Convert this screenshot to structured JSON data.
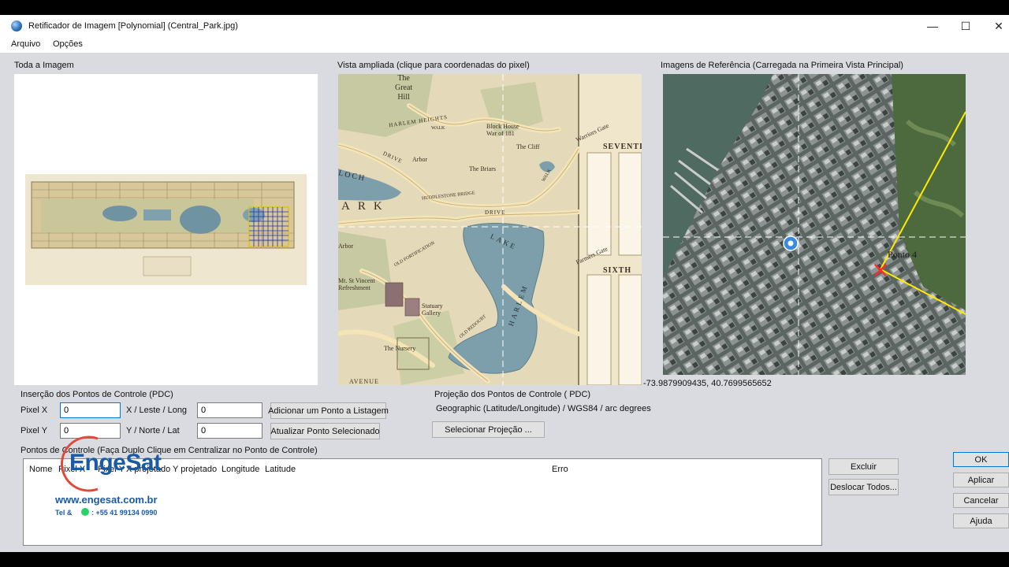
{
  "window": {
    "title": "Retificador de Imagem [Polynomial] (Central_Park.jpg)",
    "minimize_glyph": "—",
    "maximize_glyph": "☐",
    "close_glyph": "✕"
  },
  "menu": {
    "items": [
      "Arquivo",
      "Opções"
    ]
  },
  "panels": {
    "whole_image_label": "Toda a Imagem",
    "zoom_view_label": "Vista ampliada (clique para coordenadas do pixel)",
    "reference_label": "Imagens de Referência (Carregada na Primeira Vista Principal)",
    "coord_readout": "-73.9879909435, 40.7699565652"
  },
  "map_labels": {
    "the_great_hill": [
      "The",
      "Great",
      "Hill"
    ],
    "harlem_heights": "HARLEM HEIGHTS",
    "block_house": [
      "Block House",
      "War of 181"
    ],
    "warriors_gate": "Warriors Gate",
    "seventh": "SEVENTI",
    "the_cliff": "The Cliff",
    "arbor1": "Arbor",
    "the_briars": "The Briars",
    "drive": "DRIVE",
    "huddlestone": "HUDDLESTONE BRIDGE",
    "loch": "LOCH",
    "park_ark": "ARK",
    "harlem_lake": "HARLEM",
    "lake2": "LAKE",
    "farmers_gate": "Farmers Gate",
    "sixth": "SIXTH",
    "arbor2": "Arbor",
    "old_fortification": "OLD FORTIFICATION",
    "mt_st_vincent": [
      "Mt. St Vincent",
      "Refreshment"
    ],
    "statuary_gallery": [
      "Statuary",
      "Gallery"
    ],
    "old_redoubt": "OLD REDOUBT",
    "the_nursery": "The Nursery",
    "walk": "WALK",
    "avenue": "AVENUE",
    "ponto_label": "Ponto 4"
  },
  "pdc_insert": {
    "group_label": "Inserção dos Pontos de Controle (PDC)",
    "pixel_x_label": "Pixel X",
    "pixel_x_value": "0",
    "pixel_y_label": "Pixel Y",
    "pixel_y_value": "0",
    "x_east_label": "X / Leste / Long",
    "x_east_value": "0",
    "y_north_label": "Y / Norte / Lat",
    "y_north_value": "0",
    "add_button": "Adicionar um Ponto a Listagem",
    "update_button": "Atualizar Ponto Selecionado"
  },
  "projection": {
    "group_label": "Projeção dos Pontos de Controle ( PDC)",
    "value": "Geographic (Latitude/Longitude) / WGS84 / arc degrees",
    "select_button": "Selecionar Projeção ..."
  },
  "control_points": {
    "group_label": "Pontos de Controle (Faça Duplo Clique  em  Centralizar no Ponto de Controle)",
    "columns": [
      "Nome",
      "Pixel X",
      "Pixel Y",
      "X projetado",
      "Y projetado",
      "Longitude",
      "Latitude",
      "Erro"
    ],
    "delete_button": "Excluir",
    "shift_all_button": "Deslocar Todos..."
  },
  "dialog_buttons": {
    "ok": "OK",
    "apply": "Aplicar",
    "cancel": "Cancelar",
    "help": "Ajuda"
  },
  "watermark": {
    "brand": "EngeSat",
    "url": "www.engesat.com.br",
    "phone_prefix": "Tel &",
    "phone": ": +55 41 99134 0990"
  },
  "colors": {
    "dialog_bg": "#d9dbe1",
    "map_paper": "#e7dcbd",
    "water": "#7d9eab",
    "road_line": "#f2e2b3",
    "focus_blue": "#0078d7",
    "reference_line": "#ffea00",
    "brand_blue": "#1a5aa6",
    "brand_red": "#e04a3a"
  }
}
